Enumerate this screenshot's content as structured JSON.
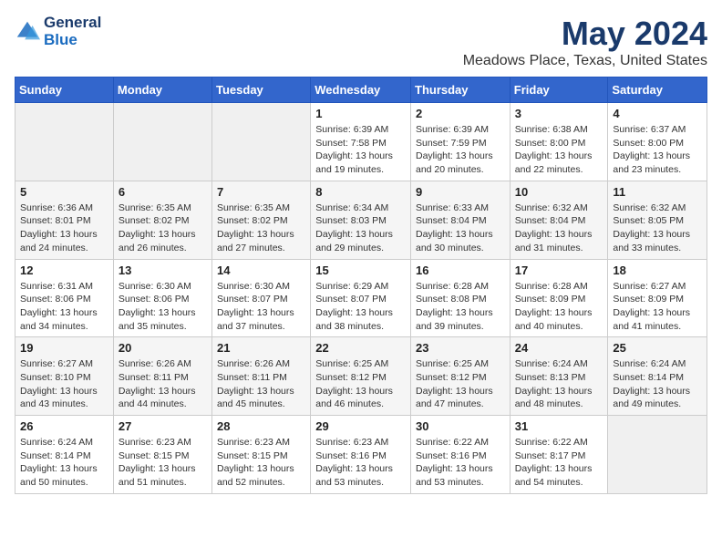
{
  "header": {
    "logo_line1": "General",
    "logo_line2": "Blue",
    "title": "May 2024",
    "subtitle": "Meadows Place, Texas, United States"
  },
  "days_of_week": [
    "Sunday",
    "Monday",
    "Tuesday",
    "Wednesday",
    "Thursday",
    "Friday",
    "Saturday"
  ],
  "weeks": [
    [
      {
        "day": "",
        "info": ""
      },
      {
        "day": "",
        "info": ""
      },
      {
        "day": "",
        "info": ""
      },
      {
        "day": "1",
        "info": "Sunrise: 6:39 AM\nSunset: 7:58 PM\nDaylight: 13 hours and 19 minutes."
      },
      {
        "day": "2",
        "info": "Sunrise: 6:39 AM\nSunset: 7:59 PM\nDaylight: 13 hours and 20 minutes."
      },
      {
        "day": "3",
        "info": "Sunrise: 6:38 AM\nSunset: 8:00 PM\nDaylight: 13 hours and 22 minutes."
      },
      {
        "day": "4",
        "info": "Sunrise: 6:37 AM\nSunset: 8:00 PM\nDaylight: 13 hours and 23 minutes."
      }
    ],
    [
      {
        "day": "5",
        "info": "Sunrise: 6:36 AM\nSunset: 8:01 PM\nDaylight: 13 hours and 24 minutes."
      },
      {
        "day": "6",
        "info": "Sunrise: 6:35 AM\nSunset: 8:02 PM\nDaylight: 13 hours and 26 minutes."
      },
      {
        "day": "7",
        "info": "Sunrise: 6:35 AM\nSunset: 8:02 PM\nDaylight: 13 hours and 27 minutes."
      },
      {
        "day": "8",
        "info": "Sunrise: 6:34 AM\nSunset: 8:03 PM\nDaylight: 13 hours and 29 minutes."
      },
      {
        "day": "9",
        "info": "Sunrise: 6:33 AM\nSunset: 8:04 PM\nDaylight: 13 hours and 30 minutes."
      },
      {
        "day": "10",
        "info": "Sunrise: 6:32 AM\nSunset: 8:04 PM\nDaylight: 13 hours and 31 minutes."
      },
      {
        "day": "11",
        "info": "Sunrise: 6:32 AM\nSunset: 8:05 PM\nDaylight: 13 hours and 33 minutes."
      }
    ],
    [
      {
        "day": "12",
        "info": "Sunrise: 6:31 AM\nSunset: 8:06 PM\nDaylight: 13 hours and 34 minutes."
      },
      {
        "day": "13",
        "info": "Sunrise: 6:30 AM\nSunset: 8:06 PM\nDaylight: 13 hours and 35 minutes."
      },
      {
        "day": "14",
        "info": "Sunrise: 6:30 AM\nSunset: 8:07 PM\nDaylight: 13 hours and 37 minutes."
      },
      {
        "day": "15",
        "info": "Sunrise: 6:29 AM\nSunset: 8:07 PM\nDaylight: 13 hours and 38 minutes."
      },
      {
        "day": "16",
        "info": "Sunrise: 6:28 AM\nSunset: 8:08 PM\nDaylight: 13 hours and 39 minutes."
      },
      {
        "day": "17",
        "info": "Sunrise: 6:28 AM\nSunset: 8:09 PM\nDaylight: 13 hours and 40 minutes."
      },
      {
        "day": "18",
        "info": "Sunrise: 6:27 AM\nSunset: 8:09 PM\nDaylight: 13 hours and 41 minutes."
      }
    ],
    [
      {
        "day": "19",
        "info": "Sunrise: 6:27 AM\nSunset: 8:10 PM\nDaylight: 13 hours and 43 minutes."
      },
      {
        "day": "20",
        "info": "Sunrise: 6:26 AM\nSunset: 8:11 PM\nDaylight: 13 hours and 44 minutes."
      },
      {
        "day": "21",
        "info": "Sunrise: 6:26 AM\nSunset: 8:11 PM\nDaylight: 13 hours and 45 minutes."
      },
      {
        "day": "22",
        "info": "Sunrise: 6:25 AM\nSunset: 8:12 PM\nDaylight: 13 hours and 46 minutes."
      },
      {
        "day": "23",
        "info": "Sunrise: 6:25 AM\nSunset: 8:12 PM\nDaylight: 13 hours and 47 minutes."
      },
      {
        "day": "24",
        "info": "Sunrise: 6:24 AM\nSunset: 8:13 PM\nDaylight: 13 hours and 48 minutes."
      },
      {
        "day": "25",
        "info": "Sunrise: 6:24 AM\nSunset: 8:14 PM\nDaylight: 13 hours and 49 minutes."
      }
    ],
    [
      {
        "day": "26",
        "info": "Sunrise: 6:24 AM\nSunset: 8:14 PM\nDaylight: 13 hours and 50 minutes."
      },
      {
        "day": "27",
        "info": "Sunrise: 6:23 AM\nSunset: 8:15 PM\nDaylight: 13 hours and 51 minutes."
      },
      {
        "day": "28",
        "info": "Sunrise: 6:23 AM\nSunset: 8:15 PM\nDaylight: 13 hours and 52 minutes."
      },
      {
        "day": "29",
        "info": "Sunrise: 6:23 AM\nSunset: 8:16 PM\nDaylight: 13 hours and 53 minutes."
      },
      {
        "day": "30",
        "info": "Sunrise: 6:22 AM\nSunset: 8:16 PM\nDaylight: 13 hours and 53 minutes."
      },
      {
        "day": "31",
        "info": "Sunrise: 6:22 AM\nSunset: 8:17 PM\nDaylight: 13 hours and 54 minutes."
      },
      {
        "day": "",
        "info": ""
      }
    ]
  ]
}
